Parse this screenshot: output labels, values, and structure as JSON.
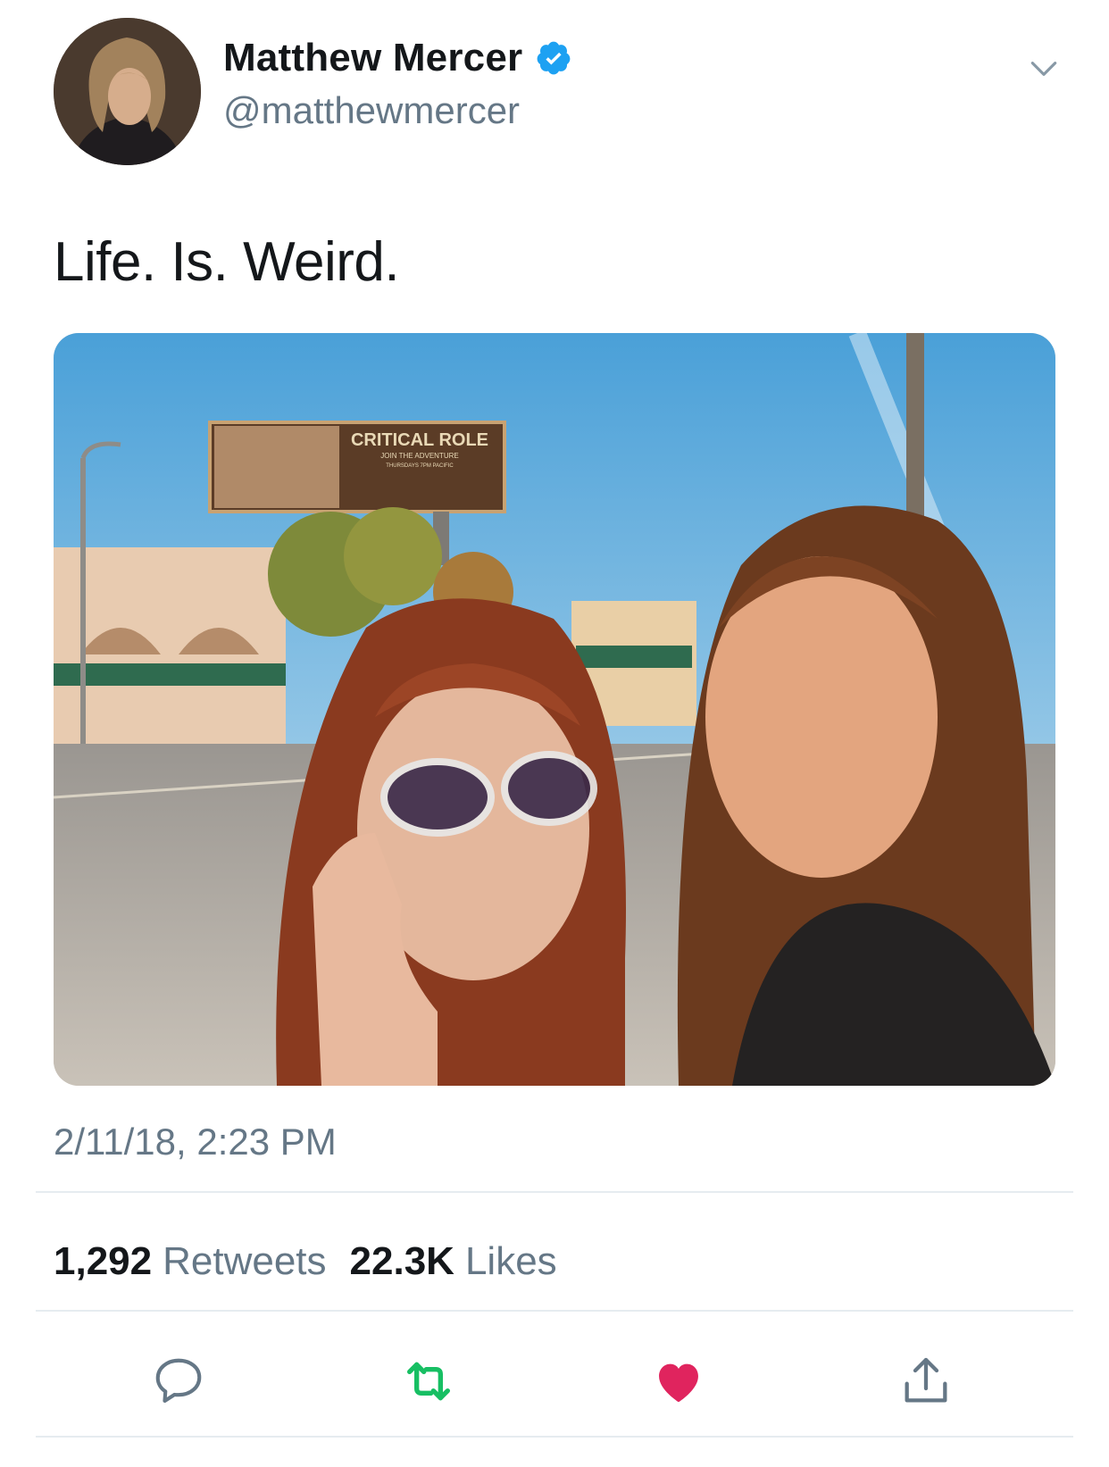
{
  "tweet": {
    "display_name": "Matthew Mercer",
    "handle": "@matthewmercer",
    "text": "Life. Is. Weird.",
    "timestamp": "2/11/18, 2:23 PM",
    "verified": true
  },
  "stats": {
    "retweets_count": "1,292",
    "retweets_label": "Retweets",
    "likes_count": "22.3K",
    "likes_label": "Likes"
  },
  "photo": {
    "billboard_title": "CRITICAL ROLE",
    "billboard_sub": "JOIN THE ADVENTURE",
    "billboard_when": "THURSDAYS 7PM PACIFIC"
  },
  "icons": {
    "verified": "verified-badge-icon",
    "caret": "chevron-down-icon",
    "reply": "reply-icon",
    "retweet": "retweet-icon",
    "like": "heart-icon",
    "share": "share-icon"
  },
  "colors": {
    "verified": "#1da1f2",
    "retweet": "#17bf63",
    "like": "#e0245e",
    "secondary_text": "#657786"
  }
}
